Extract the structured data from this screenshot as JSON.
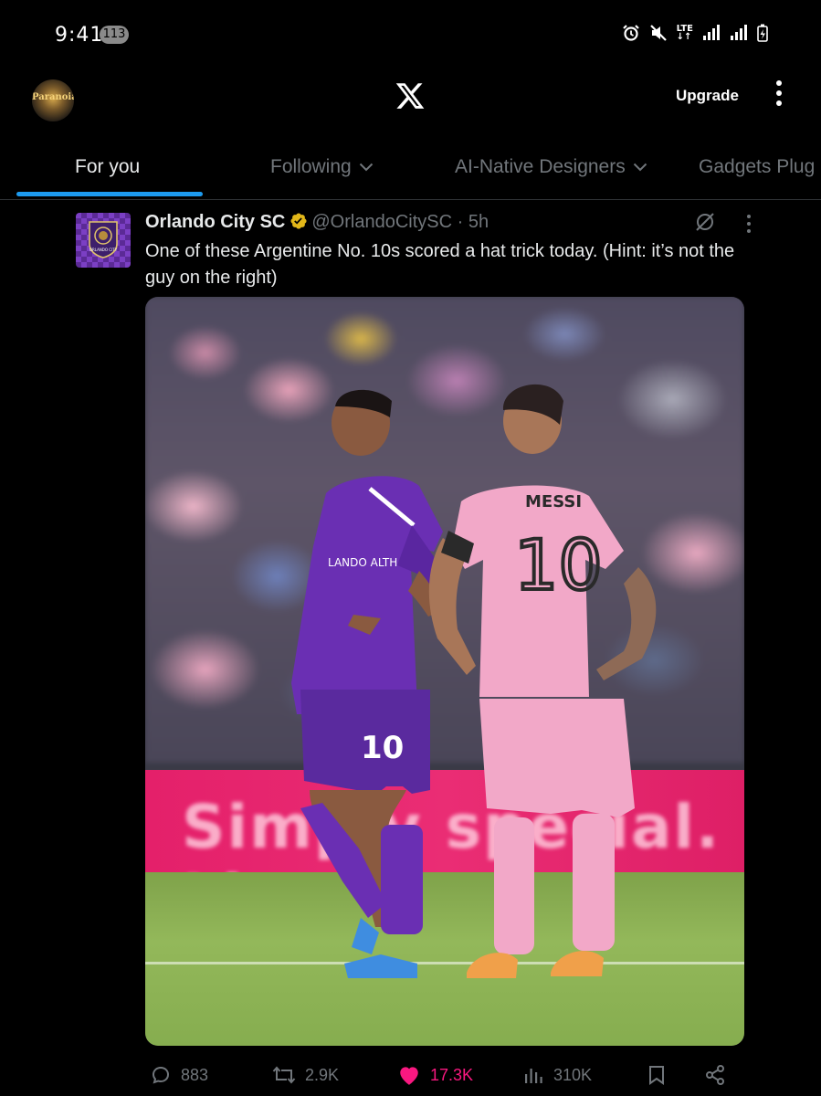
{
  "status_bar": {
    "time": "9:41",
    "notification_count": "113",
    "network_label": "LTE"
  },
  "top_bar": {
    "avatar_label": "Paranoia",
    "upgrade_label": "Upgrade"
  },
  "tabs": [
    {
      "label": "For you",
      "active": true
    },
    {
      "label": "Following"
    },
    {
      "label": "AI-Native Designers"
    },
    {
      "label": "Gadgets Plug"
    }
  ],
  "post": {
    "author_name": "Orlando City SC",
    "author_handle": "@OrlandoCitySC",
    "separator": "·",
    "timestamp": "5h",
    "text": "One of these Argentine No. 10s scored a hat trick today. (Hint: it’s not the guy on the right)",
    "avatar_crest_text": "ORLANDO CITY",
    "media": {
      "right_player_name": "MESSI",
      "right_player_number": "10",
      "left_player_number": "10",
      "left_player_sponsor": "LANDO ALTH",
      "banner_text": "Simply special. Live it m"
    },
    "actions": {
      "replies": "883",
      "reposts": "2.9K",
      "likes": "17.3K",
      "views": "310K"
    }
  },
  "colors": {
    "accent": "#1d9bf0",
    "like": "#f91880",
    "verified": "#e2b719",
    "muted_text": "#71767b"
  }
}
